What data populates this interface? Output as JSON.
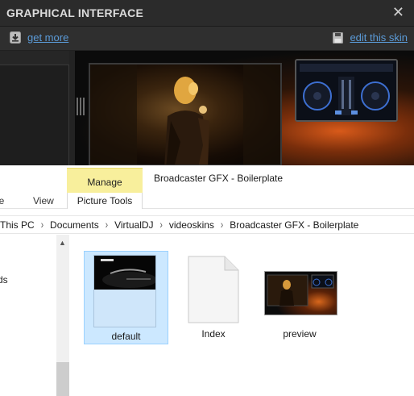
{
  "vdj_dialog": {
    "title": "GRAPHICAL INTERFACE",
    "close_glyph": "✕",
    "toolbar": {
      "get_more": {
        "label": "get more",
        "icon": "download-icon"
      },
      "edit_skin": {
        "label": "edit this skin",
        "icon": "floppy-disk-icon"
      }
    },
    "colors": {
      "background": "#232323",
      "title_text": "#dcdcdc",
      "link": "#5b9bd8"
    }
  },
  "explorer": {
    "ribbon": {
      "contextual_tab": {
        "label": "Manage",
        "group_label": "Picture Tools",
        "color": "#f8ef9c"
      },
      "window_title": "Broadcaster GFX - Boilerplate",
      "tabs": [
        "are",
        "View"
      ]
    },
    "address": {
      "crumbs": [
        "This PC",
        "Documents",
        "VirtualDJ",
        "videoskins",
        "Broadcaster GFX - Boilerplate"
      ],
      "separator": "›"
    },
    "nav_pane": {
      "partial_label": "ds"
    },
    "files": [
      {
        "name": "default",
        "kind": "image",
        "selected": true
      },
      {
        "name": "Index",
        "kind": "document",
        "selected": false
      },
      {
        "name": "preview",
        "kind": "image",
        "selected": false
      }
    ],
    "colors": {
      "selection_fill": "#cce8ff",
      "selection_border": "#99d1ff"
    }
  }
}
